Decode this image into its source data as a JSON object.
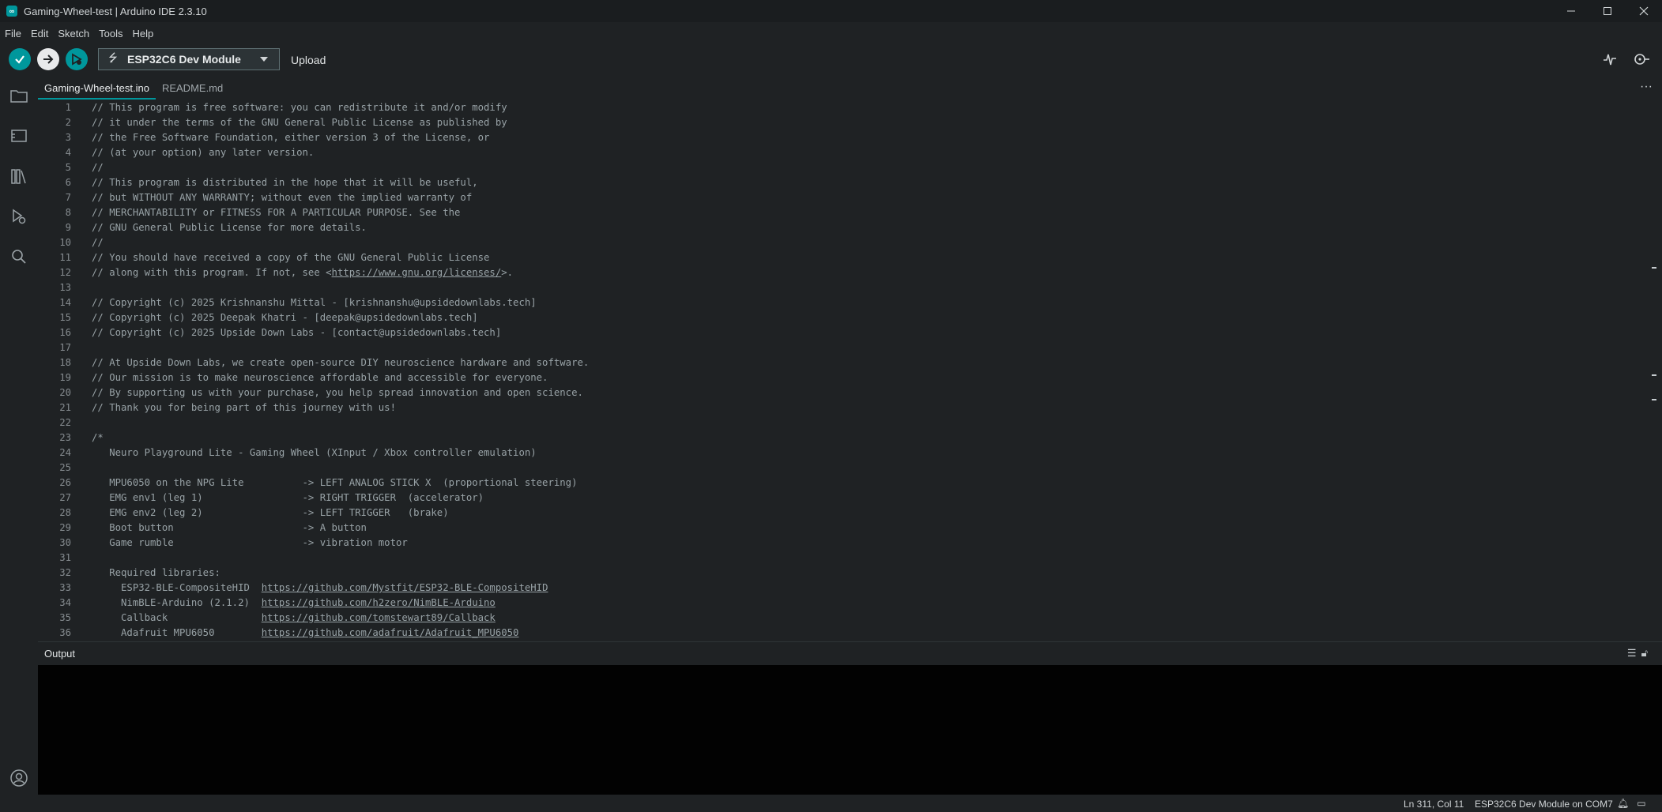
{
  "window": {
    "title": "Gaming-Wheel-test | Arduino IDE 2.3.10",
    "controls": [
      "minimize",
      "maximize",
      "close"
    ]
  },
  "menu": [
    "File",
    "Edit",
    "Sketch",
    "Tools",
    "Help"
  ],
  "toolbar": {
    "board": "ESP32C6 Dev Module",
    "upload_label": "Upload",
    "buttons": [
      "verify-icon",
      "upload-icon",
      "debug-icon",
      "serial-plotter-icon",
      "serial-monitor-icon"
    ]
  },
  "sidebar": {
    "icons": [
      "folder-icon",
      "boards-manager-icon",
      "library-manager-icon",
      "debug-icon",
      "search-icon",
      "profile-icon"
    ]
  },
  "tabs": [
    {
      "label": "Gaming-Wheel-test.ino",
      "active": true
    },
    {
      "label": "README.md",
      "active": false
    }
  ],
  "code": [
    {
      "n": "1",
      "text": "// This program is free software: you can redistribute it and/or modify"
    },
    {
      "n": "2",
      "text": "// it under the terms of the GNU General Public License as published by"
    },
    {
      "n": "3",
      "text": "// the Free Software Foundation, either version 3 of the License, or"
    },
    {
      "n": "4",
      "text": "// (at your option) any later version."
    },
    {
      "n": "5",
      "text": "//"
    },
    {
      "n": "6",
      "text": "// This program is distributed in the hope that it will be useful,"
    },
    {
      "n": "7",
      "text": "// but WITHOUT ANY WARRANTY; without even the implied warranty of"
    },
    {
      "n": "8",
      "text": "// MERCHANTABILITY or FITNESS FOR A PARTICULAR PURPOSE. See the"
    },
    {
      "n": "9",
      "text": "// GNU General Public License for more details."
    },
    {
      "n": "10",
      "text": "//"
    },
    {
      "n": "11",
      "text": "// You should have received a copy of the GNU General Public License"
    },
    {
      "n": "12",
      "text": "// along with this program. If not, see <",
      "link": "https://www.gnu.org/licenses/",
      "after": ">."
    },
    {
      "n": "13",
      "text": ""
    },
    {
      "n": "14",
      "text": "// Copyright (c) 2025 Krishnanshu Mittal - [krishnanshu@upsidedownlabs.tech]"
    },
    {
      "n": "15",
      "text": "// Copyright (c) 2025 Deepak Khatri - [deepak@upsidedownlabs.tech]"
    },
    {
      "n": "16",
      "text": "// Copyright (c) 2025 Upside Down Labs - [contact@upsidedownlabs.tech]"
    },
    {
      "n": "17",
      "text": ""
    },
    {
      "n": "18",
      "text": "// At Upside Down Labs, we create open-source DIY neuroscience hardware and software."
    },
    {
      "n": "19",
      "text": "// Our mission is to make neuroscience affordable and accessible for everyone."
    },
    {
      "n": "20",
      "text": "// By supporting us with your purchase, you help spread innovation and open science."
    },
    {
      "n": "21",
      "text": "// Thank you for being part of this journey with us!"
    },
    {
      "n": "22",
      "text": ""
    },
    {
      "n": "23",
      "text": "/*"
    },
    {
      "n": "24",
      "text": "   Neuro Playground Lite - Gaming Wheel (XInput / Xbox controller emulation)"
    },
    {
      "n": "25",
      "text": ""
    },
    {
      "n": "26",
      "text": "   MPU6050 on the NPG Lite          -> LEFT ANALOG STICK X  (proportional steering)"
    },
    {
      "n": "27",
      "text": "   EMG env1 (leg 1)                 -> RIGHT TRIGGER  (accelerator)"
    },
    {
      "n": "28",
      "text": "   EMG env2 (leg 2)                 -> LEFT TRIGGER   (brake)"
    },
    {
      "n": "29",
      "text": "   Boot button                      -> A button"
    },
    {
      "n": "30",
      "text": "   Game rumble                      -> vibration motor"
    },
    {
      "n": "31",
      "text": ""
    },
    {
      "n": "32",
      "text": "   Required libraries:"
    },
    {
      "n": "33",
      "text": "     ESP32-BLE-CompositeHID  ",
      "link": "https://github.com/Mystfit/ESP32-BLE-CompositeHID",
      "after": ""
    },
    {
      "n": "34",
      "text": "     NimBLE-Arduino (2.1.2)  ",
      "link": "https://github.com/h2zero/NimBLE-Arduino",
      "after": ""
    },
    {
      "n": "35",
      "text": "     Callback                ",
      "link": "https://github.com/tomstewart89/Callback",
      "after": ""
    },
    {
      "n": "36",
      "text": "     Adafruit MPU6050        ",
      "link": "https://github.com/adafruit/Adafruit_MPU6050",
      "after": ""
    }
  ],
  "output": {
    "title": "Output",
    "icons": [
      "clear-output-icon",
      "lock-scroll-icon"
    ]
  },
  "status": {
    "position": "Ln 311, Col 11",
    "board": "ESP32C6 Dev Module on COM7",
    "icons": [
      "notifications-icon",
      "toggle-panel-icon"
    ]
  }
}
